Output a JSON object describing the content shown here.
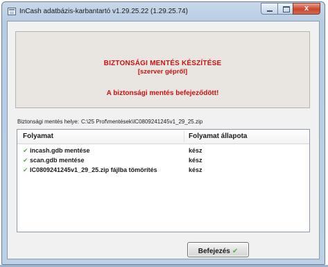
{
  "window": {
    "title": "InCash adatbázis-karbantartó v1.29.25.22 (1.29.25.74)",
    "buttons": {
      "minimize": "",
      "maximize": "",
      "close": "x"
    }
  },
  "banner": {
    "title": "BIZTONSÁGI MENTÉS KÉSZÍTÉSE",
    "subtitle": "[szerver gépről]",
    "status": "A biztonsági mentés befejeződött!",
    "accent_color": "#cc1111"
  },
  "backup": {
    "location_label": "Biztonsági mentés helye:",
    "location_path": "C:\\25 Prof\\mentések\\IC0809241245v1_29_25.zip"
  },
  "table": {
    "headers": [
      "Folyamat",
      "Folyamat állapota"
    ],
    "rows": [
      {
        "icon": "checkmark-icon",
        "process": "incash.gdb mentése",
        "status": "kész"
      },
      {
        "icon": "checkmark-icon",
        "process": "scan.gdb mentése",
        "status": "kész"
      },
      {
        "icon": "checkmark-icon",
        "process": "IC0809241245v1_29_25.zip fájlba tömörítés",
        "status": "kész"
      }
    ],
    "check_color": "#55b34a"
  },
  "footer": {
    "finish_label": "Befejezés",
    "finish_icon": "checkmark-icon"
  }
}
